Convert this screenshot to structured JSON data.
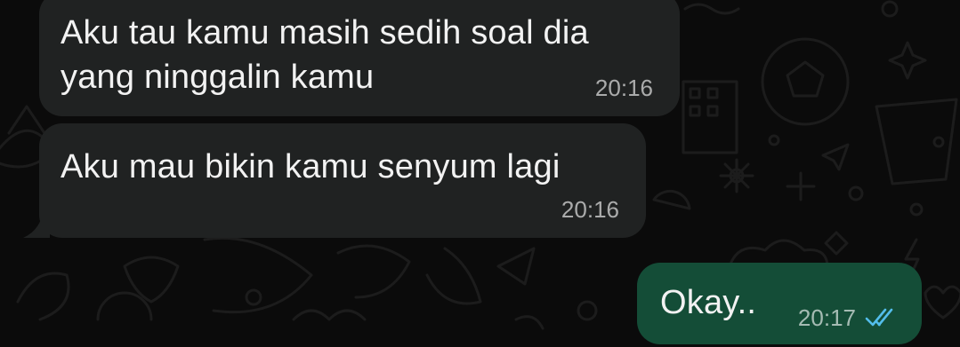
{
  "chat": {
    "messages": [
      {
        "direction": "incoming",
        "text": "Aku tau kamu masih sedih soal dia\nyang ninggalin kamu",
        "time": "20:16"
      },
      {
        "direction": "incoming",
        "text": "Aku mau bikin kamu senyum lagi",
        "time": "20:16"
      },
      {
        "direction": "outgoing",
        "text": "Okay..",
        "time": "20:17",
        "status_icon": "double-check-read-icon"
      }
    ]
  },
  "colors": {
    "background": "#0b0b0b",
    "incoming_bubble": "#202222",
    "outgoing_bubble": "#144d37",
    "text": "#f2f2f2",
    "timestamp": "#9e9e9e",
    "read_receipt": "#53bdeb"
  }
}
